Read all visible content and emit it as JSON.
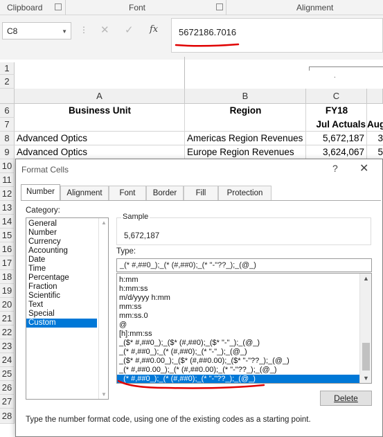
{
  "ribbon": {
    "groups": [
      "Clipboard",
      "Font",
      "Alignment"
    ]
  },
  "formula_bar": {
    "name_box": "C8",
    "cancel_icon": "cancel-x-icon",
    "enter_icon": "enter-check-icon",
    "fx_label": "fx",
    "formula_value": "5672186.7016"
  },
  "sheet": {
    "row_numbers": [
      "1",
      "2",
      "6",
      "7",
      "8",
      "9",
      "10",
      "11",
      "12",
      "13",
      "14",
      "15",
      "16",
      "17",
      "18",
      "19",
      "20",
      "21",
      "22",
      "23",
      "24",
      "25",
      "26",
      "27",
      "28"
    ],
    "column_headers": [
      "A",
      "B",
      "C"
    ],
    "row6": {
      "a": "Business Unit",
      "b": "Region",
      "c": "FY18"
    },
    "row7": {
      "c": "Jul Actuals",
      "d": "Aug"
    },
    "row8": {
      "a": "Advanced Optics",
      "b": "Americas Region Revenues",
      "c": "5,672,187",
      "d": "3"
    },
    "row9": {
      "a": "Advanced Optics",
      "b": "Europe Region Revenues",
      "c": "3,624,067",
      "d": "5"
    },
    "outline_dot": "."
  },
  "dialog": {
    "title": "Format Cells",
    "help": "?",
    "close": "✕",
    "tabs": [
      "Number",
      "Alignment",
      "Font",
      "Border",
      "Fill",
      "Protection"
    ],
    "active_tab": "Number",
    "category_label": "Category:",
    "categories": [
      "General",
      "Number",
      "Currency",
      "Accounting",
      "Date",
      "Time",
      "Percentage",
      "Fraction",
      "Scientific",
      "Text",
      "Special",
      "Custom"
    ],
    "selected_category": "Custom",
    "sample_label": "Sample",
    "sample_value": "5,672,187",
    "type_label": "Type:",
    "type_value": "_(* #,##0_);_(* (#,##0);_(* \"-\"??_);_(@_)",
    "format_codes": [
      "h:mm",
      "h:mm:ss",
      "m/d/yyyy h:mm",
      "mm:ss",
      "mm:ss.0",
      "@",
      "[h]:mm:ss",
      "_($* #,##0_);_($* (#,##0);_($* \"-\"_);_(@_)",
      "_(* #,##0_);_(* (#,##0);_(* \"-\"_);_(@_)",
      "_($* #,##0.00_);_($* (#,##0.00);_($* \"-\"??_);_(@_)",
      "_(* #,##0.00_);_(* (#,##0.00);_(* \"-\"??_);_(@_)",
      "_(* #,##0_);_(* (#,##0);_(* \"-\"??_);_(@_)"
    ],
    "selected_code_index": 11,
    "delete_button": "Delete",
    "hint": "Type the number format code, using one of the existing codes as a starting point."
  },
  "colors": {
    "selection": "#0078d7",
    "annotation": "#e00000"
  }
}
